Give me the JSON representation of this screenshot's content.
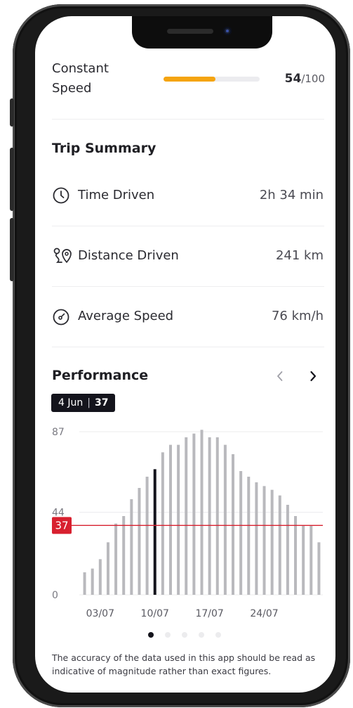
{
  "constant_speed": {
    "label": "Constant Speed",
    "score": "54",
    "score_max": "/100",
    "progress_fraction": 0.54,
    "bar_color": "#f5a40f"
  },
  "trip_summary": {
    "title": "Trip Summary",
    "rows": [
      {
        "icon": "clock-icon",
        "label": "Time Driven",
        "value": "2h 34 min"
      },
      {
        "icon": "route-pin-icon",
        "label": "Distance Driven",
        "value": "241 km"
      },
      {
        "icon": "speedometer-icon",
        "label": "Average Speed",
        "value": "76 km/h"
      }
    ]
  },
  "performance": {
    "title": "Performance",
    "prev_icon": "chevron-left-icon",
    "next_icon": "chevron-right-icon",
    "selected_date": "4 Jun",
    "selected_value": "37",
    "selected_separator": "|"
  },
  "chart_data": {
    "type": "bar",
    "y_ticks": [
      "87",
      "44",
      "0"
    ],
    "ylim": [
      0,
      90
    ],
    "x_tick_labels": [
      "03/07",
      "10/07",
      "17/07",
      "24/07"
    ],
    "x_tick_indices": [
      2,
      9,
      16,
      23
    ],
    "values": [
      12,
      14,
      19,
      28,
      38,
      42,
      51,
      57,
      63,
      67,
      76,
      80,
      80,
      84,
      86,
      88,
      84,
      84,
      80,
      75,
      66,
      63,
      60,
      58,
      56,
      53,
      48,
      42,
      37,
      37,
      28
    ],
    "highlight_index": 9,
    "highlight_value": 76,
    "reference_value": 37,
    "reference_label": "37",
    "bar_color": "#b9b9bd",
    "highlight_color": "#14141c",
    "reference_color": "#d8202f"
  },
  "pager": {
    "count": 5,
    "active_index": 0
  },
  "footnote": "The accuracy of the data used in this app should be read as indicative of magnitude rather than exact figures."
}
